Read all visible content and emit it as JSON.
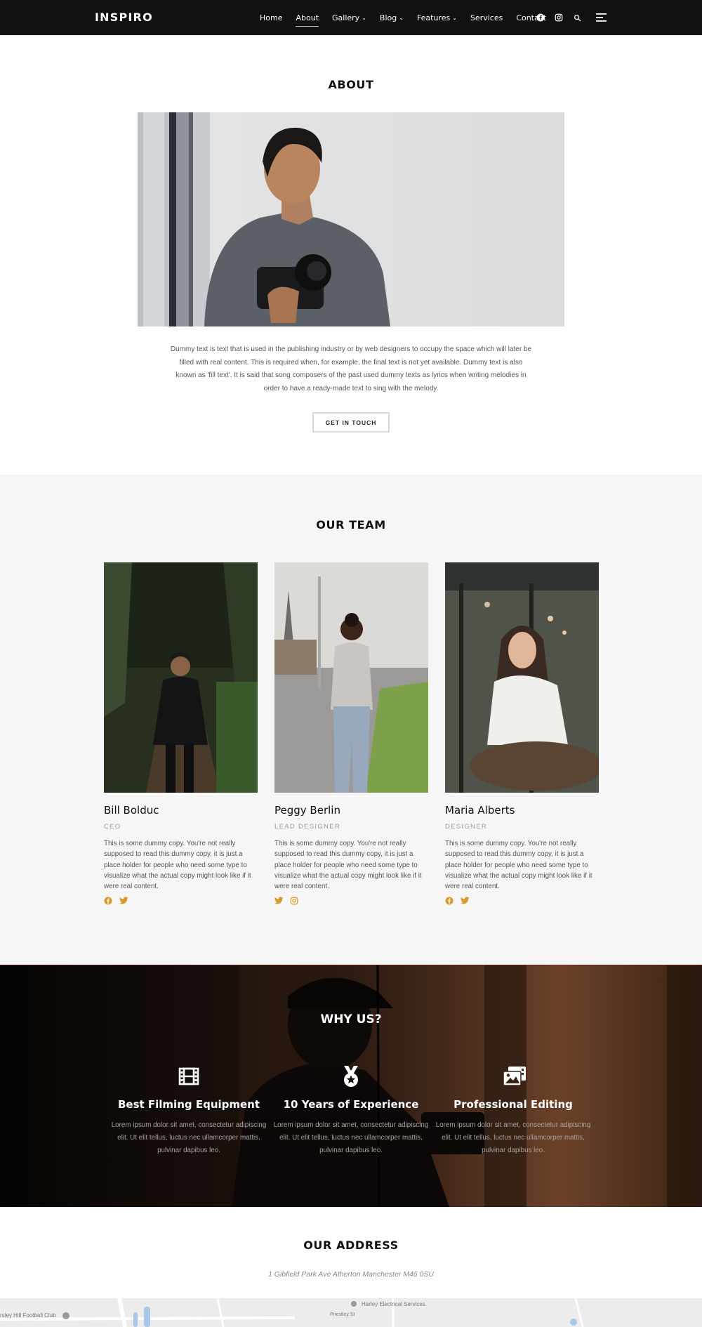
{
  "brand": {
    "logo": "INSPIRO"
  },
  "nav": {
    "items": [
      {
        "label": "Home"
      },
      {
        "label": "About",
        "active": true
      },
      {
        "label": "Gallery",
        "dropdown": true
      },
      {
        "label": "Blog",
        "dropdown": true
      },
      {
        "label": "Features",
        "dropdown": true
      },
      {
        "label": "Services"
      },
      {
        "label": "Contact"
      }
    ],
    "icons": [
      "facebook-icon",
      "instagram-icon",
      "search-icon",
      "menu-icon"
    ]
  },
  "about": {
    "title": "ABOUT",
    "text": "Dummy text is text that is used in the publishing industry or by web designers to occupy the space which will later be filled with real content. This is required when, for example, the final text is not yet available. Dummy text is also known as 'fill text'. It is said that song composers of the past used dummy texts as lyrics when writing melodies in order to have a ready-made text to sing with the melody.",
    "button": "GET IN TOUCH"
  },
  "team": {
    "title": "OUR TEAM",
    "members": [
      {
        "name": "Bill Bolduc",
        "role": "CEO",
        "bio": "This is some dummy copy. You're not really supposed to read this dummy copy, it is just a place holder for people who need some type to visualize what the actual copy might look like if it were real content.",
        "social": [
          "facebook-icon",
          "twitter-icon"
        ]
      },
      {
        "name": "Peggy Berlin",
        "role": "LEAD DESIGNER",
        "bio": "This is some dummy copy. You're not really supposed to read this dummy copy, it is just a place holder for people who need some type to visualize what the actual copy might look like if it were real content.",
        "social": [
          "twitter-icon",
          "instagram-icon"
        ]
      },
      {
        "name": "Maria Alberts",
        "role": "DESIGNER",
        "bio": "This is some dummy copy. You're not really supposed to read this dummy copy, it is just a place holder for people who need some type to visualize what the actual copy might look like if it were real content.",
        "social": [
          "facebook-icon",
          "twitter-icon"
        ]
      }
    ]
  },
  "why": {
    "title": "WHY US?",
    "features": [
      {
        "icon": "film-icon",
        "title": "Best Filming Equipment",
        "text": "Lorem ipsum dolor sit amet, consectetur adipiscing elit. Ut elit tellus, luctus nec ullamcorper mattis, pulvinar dapibus leo."
      },
      {
        "icon": "medal-icon",
        "title": "10 Years of Experience",
        "text": "Lorem ipsum dolor sit amet, consectetur adipiscing elit. Ut elit tellus, luctus nec ullamcorper mattis, pulvinar dapibus leo."
      },
      {
        "icon": "images-icon",
        "title": "Professional Editing",
        "text": "Lorem ipsum dolor sit amet, consectetur adipiscing elit. Ut elit tellus, luctus nec ullamcorper mattis, pulvinar dapibus leo."
      }
    ]
  },
  "address": {
    "title": "OUR ADDRESS",
    "line": "1 Gibfield Park Ave Atherton Manchester M46 0SU",
    "map_labels": [
      "rsley Hill Football Club",
      "Harley Electrical Services",
      "Priestley St"
    ]
  },
  "colors": {
    "navbar": "#111111",
    "accent": "#d89a2b",
    "team_bg": "#f6f6f6",
    "why_bg": "#120a07"
  }
}
